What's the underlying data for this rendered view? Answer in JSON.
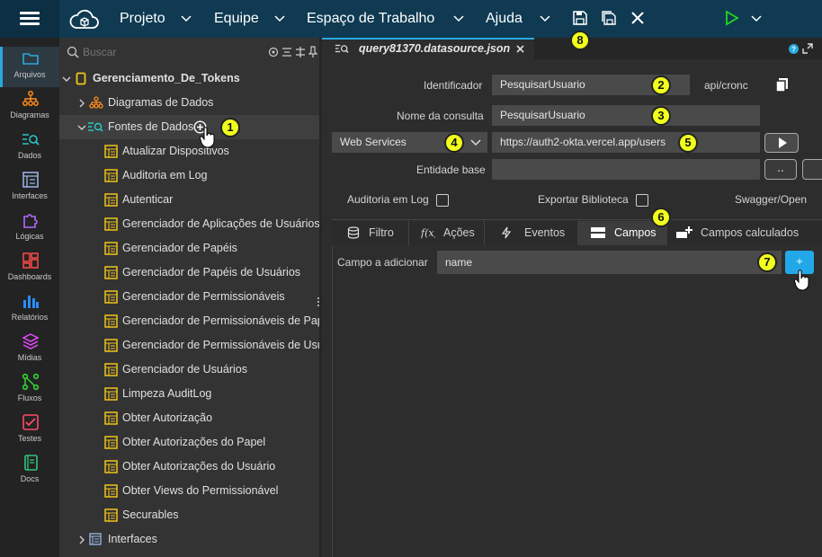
{
  "topbar": {
    "menus": [
      "Projeto",
      "Equipe",
      "Espaço de Trabalho",
      "Ajuda"
    ]
  },
  "leftnav": {
    "items": [
      {
        "label": "Arquivos",
        "icon": "folder-icon",
        "active": true
      },
      {
        "label": "Diagramas",
        "icon": "diagram-icon"
      },
      {
        "label": "Dados",
        "icon": "data-icon"
      },
      {
        "label": "Interfaces",
        "icon": "interfaces-icon"
      },
      {
        "label": "Lógicas",
        "icon": "puzzle-icon"
      },
      {
        "label": "Dashboards",
        "icon": "dashboard-icon"
      },
      {
        "label": "Relatórios",
        "icon": "bar-chart-icon"
      },
      {
        "label": "Mídias",
        "icon": "layers-icon"
      },
      {
        "label": "Fluxos",
        "icon": "flow-icon"
      },
      {
        "label": "Testes",
        "icon": "checklist-icon"
      },
      {
        "label": "Docs",
        "icon": "book-icon"
      }
    ],
    "colors": [
      "#29a8e0",
      "#ff8c1a",
      "#29c6c6",
      "#9db8e8",
      "#b468ff",
      "#ff4a4a",
      "#2a8cff",
      "#e64aff",
      "#33d633",
      "#ff4a6a",
      "#33c47a"
    ]
  },
  "tree": {
    "search_placeholder": "Buscar",
    "root": "Gerenciamento_De_Tokens",
    "diagramas": "Diagramas de Dados",
    "fontes": "Fontes de Dados",
    "items": [
      "Atualizar Dispositivos",
      "Auditoria em Log",
      "Autenticar",
      "Gerenciador de Aplicações de Usuários",
      "Gerenciador de Papéis",
      "Gerenciador de Papéis de Usuários",
      "Gerenciador de Permissionáveis",
      "Gerenciador de Permissionáveis de Pape",
      "Gerenciador de Permissionáveis de Usu",
      "Gerenciador de Usuários",
      "Limpeza AuditLog",
      "Obter Autorização",
      "Obter Autorizações do Papel",
      "Obter Autorizações do Usuário",
      "Obter Views do Permissionável",
      "Securables"
    ],
    "interfaces": "Interfaces"
  },
  "editor": {
    "tab_title": "query81370.datasource.json",
    "identificador_label": "Identificador",
    "identificador_value": "PesquisarUsuario",
    "api_path": "api/cronc",
    "nome_label": "Nome da consulta",
    "nome_value": "PesquisarUsuario",
    "source_type": "Web Services",
    "url": "https://auth2-okta.vercel.app/users",
    "entidade_label": "Entidade base",
    "entidade_value": "",
    "auditoria_label": "Auditoria em Log",
    "exportar_label": "Exportar Biblioteca",
    "swagger_label": "Swagger/Open",
    "subtabs": [
      "Filtro",
      "Ações",
      "Eventos",
      "Campos",
      "Campos calculados"
    ],
    "campo_label": "Campo a adicionar",
    "campo_value": "name",
    "add_button": "+"
  },
  "badges": [
    "1",
    "2",
    "3",
    "4",
    "5",
    "6",
    "7",
    "8"
  ],
  "colors": {
    "accent": "#29a8e0",
    "badge": "#f2ff1c",
    "folder": "#f0c419",
    "topbar": "#0f3a52"
  }
}
